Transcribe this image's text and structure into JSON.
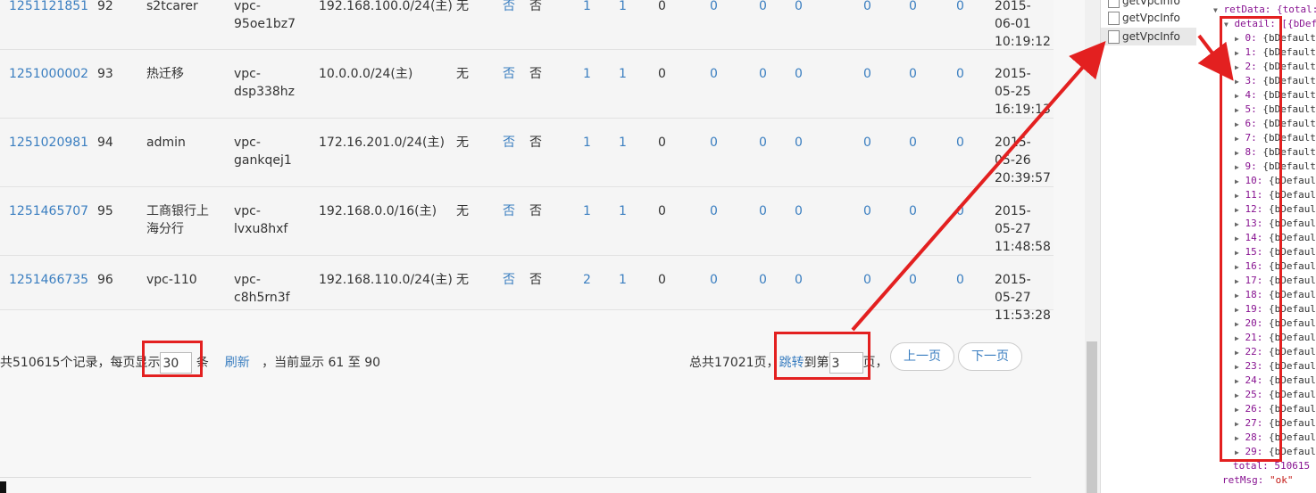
{
  "table": {
    "rows": [
      {
        "id": "1251121851",
        "num": "92",
        "name": "s2tcarer",
        "vpc": "vpc-95oe1bz7",
        "cidr": "192.168.100.0/24(主)",
        "wu": "无",
        "fou": "否",
        "fou2": "否",
        "n1": "1",
        "n2": "1",
        "n3": "0",
        "n4": "0",
        "n5": "0",
        "n6": "0",
        "n7": "0",
        "n8": "0",
        "n9": "0",
        "date": "2015-06-01 10:19:12"
      },
      {
        "id": "1251000002",
        "num": "93",
        "name": "热迁移",
        "vpc": "vpc-dsp338hz",
        "cidr": "10.0.0.0/24(主)",
        "wu": "无",
        "fou": "否",
        "fou2": "否",
        "n1": "1",
        "n2": "1",
        "n3": "0",
        "n4": "0",
        "n5": "0",
        "n6": "0",
        "n7": "0",
        "n8": "0",
        "n9": "0",
        "date": "2015-05-25 16:19:13"
      },
      {
        "id": "1251020981",
        "num": "94",
        "name": "admin",
        "vpc": "vpc-gankqej1",
        "cidr": "172.16.201.0/24(主)",
        "wu": "无",
        "fou": "否",
        "fou2": "否",
        "n1": "1",
        "n2": "1",
        "n3": "0",
        "n4": "0",
        "n5": "0",
        "n6": "0",
        "n7": "0",
        "n8": "0",
        "n9": "0",
        "date": "2015-05-26 20:39:57"
      },
      {
        "id": "1251465707",
        "num": "95",
        "name": "工商银行上海分行",
        "vpc": "vpc-lvxu8hxf",
        "cidr": "192.168.0.0/16(主)",
        "wu": "无",
        "fou": "否",
        "fou2": "否",
        "n1": "1",
        "n2": "1",
        "n3": "0",
        "n4": "0",
        "n5": "0",
        "n6": "0",
        "n7": "0",
        "n8": "0",
        "n9": "0",
        "date": "2015-05-27 11:48:58"
      },
      {
        "id": "1251466735",
        "num": "96",
        "name": "vpc-110",
        "vpc": "vpc-c8h5rn3f",
        "cidr": "192.168.110.0/24(主)",
        "wu": "无",
        "fou": "否",
        "fou2": "否",
        "n1": "2",
        "n2": "1",
        "n3": "0",
        "n4": "0",
        "n5": "0",
        "n6": "0",
        "n7": "0",
        "n8": "0",
        "n9": "0",
        "date": "2015-05-27 11:53:28"
      }
    ]
  },
  "pager": {
    "total_prefix": "共510615个记录，每页显示",
    "per_page": "30",
    "per_page_suffix": "条",
    "refresh": "刷新",
    "showing": "，当前显示 61 至 90",
    "total_pages": "总共17021页，",
    "jump": "跳转",
    "to_page": "到第",
    "page_value": "3",
    "page_suffix": "页，",
    "prev": "上一页",
    "next": "下一页"
  },
  "network": {
    "items": [
      "getVpcInfo",
      "getVpcInfo",
      "getVpcInfo"
    ]
  },
  "console": {
    "retData": "retData: {total:",
    "detail": "detail: [{bDef",
    "entry_suffix": "{bDefault",
    "total": "total: 510615",
    "retMsg_key": "retMsg:",
    "retMsg_val": "\"ok\""
  },
  "colors": {
    "annotation": "#e32020",
    "link": "#3a7ec0"
  }
}
